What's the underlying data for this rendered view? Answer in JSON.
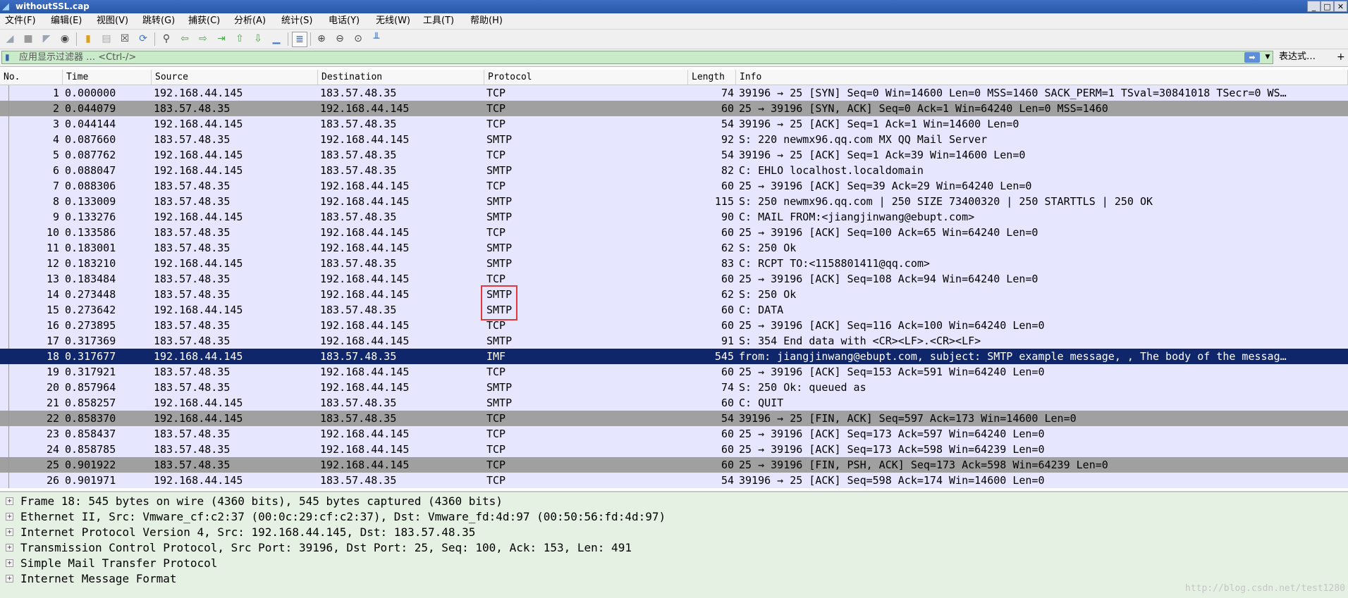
{
  "window": {
    "title": "withoutSSL.cap",
    "buttons": [
      "_",
      "□",
      "✕"
    ]
  },
  "menu": [
    "文件(F)",
    "编辑(E)",
    "视图(V)",
    "跳转(G)",
    "捕获(C)",
    "分析(A)",
    "统计(S)",
    "电话(Y)",
    "无线(W)",
    "工具(T)",
    "帮助(H)"
  ],
  "toolbar": {
    "icons": [
      "shark-fin-icon",
      "stop-icon",
      "restart-icon",
      "options-icon",
      "open-file-icon",
      "save-icon",
      "close-file-icon",
      "reload-icon",
      "find-icon",
      "go-back-icon",
      "go-forward-icon",
      "go-to-packet-icon",
      "first-packet-icon",
      "last-packet-icon",
      "auto-scroll-icon",
      "colorize-icon",
      "zoom-in-icon",
      "zoom-out-icon",
      "zoom-normal-icon",
      "resize-columns-icon"
    ]
  },
  "filter": {
    "placeholder": "应用显示过滤器 … <Ctrl-/>",
    "expression_label": "表达式…",
    "plus_label": "+"
  },
  "columns": {
    "no": "No.",
    "time": "Time",
    "source": "Source",
    "destination": "Destination",
    "protocol": "Protocol",
    "length": "Length",
    "info": "Info"
  },
  "packets": [
    {
      "no": "1",
      "time": "0.000000",
      "src": "192.168.44.145",
      "dst": "183.57.48.35",
      "proto": "TCP",
      "len": "74",
      "info": "39196 → 25 [SYN] Seq=0 Win=14600 Len=0 MSS=1460 SACK_PERM=1 TSval=30841018 TSecr=0 WS…",
      "bg": "#e7e6ff"
    },
    {
      "no": "2",
      "time": "0.044079",
      "src": "183.57.48.35",
      "dst": "192.168.44.145",
      "proto": "TCP",
      "len": "60",
      "info": "25 → 39196 [SYN, ACK] Seq=0 Ack=1 Win=64240 Len=0 MSS=1460",
      "bg": "#a0a0a0"
    },
    {
      "no": "3",
      "time": "0.044144",
      "src": "192.168.44.145",
      "dst": "183.57.48.35",
      "proto": "TCP",
      "len": "54",
      "info": "39196 → 25 [ACK] Seq=1 Ack=1 Win=14600 Len=0",
      "bg": "#e7e6ff"
    },
    {
      "no": "4",
      "time": "0.087660",
      "src": "183.57.48.35",
      "dst": "192.168.44.145",
      "proto": "SMTP",
      "len": "92",
      "info": "S: 220 newmx96.qq.com MX QQ Mail Server",
      "bg": "#e7e6ff"
    },
    {
      "no": "5",
      "time": "0.087762",
      "src": "192.168.44.145",
      "dst": "183.57.48.35",
      "proto": "TCP",
      "len": "54",
      "info": "39196 → 25 [ACK] Seq=1 Ack=39 Win=14600 Len=0",
      "bg": "#e7e6ff"
    },
    {
      "no": "6",
      "time": "0.088047",
      "src": "192.168.44.145",
      "dst": "183.57.48.35",
      "proto": "SMTP",
      "len": "82",
      "info": "C: EHLO localhost.localdomain",
      "bg": "#e7e6ff"
    },
    {
      "no": "7",
      "time": "0.088306",
      "src": "183.57.48.35",
      "dst": "192.168.44.145",
      "proto": "TCP",
      "len": "60",
      "info": "25 → 39196 [ACK] Seq=39 Ack=29 Win=64240 Len=0",
      "bg": "#e7e6ff"
    },
    {
      "no": "8",
      "time": "0.133009",
      "src": "183.57.48.35",
      "dst": "192.168.44.145",
      "proto": "SMTP",
      "len": "115",
      "info": "S: 250 newmx96.qq.com | 250 SIZE 73400320 | 250 STARTTLS | 250 OK",
      "bg": "#e7e6ff"
    },
    {
      "no": "9",
      "time": "0.133276",
      "src": "192.168.44.145",
      "dst": "183.57.48.35",
      "proto": "SMTP",
      "len": "90",
      "info": "C: MAIL FROM:<jiangjinwang@ebupt.com>",
      "bg": "#e7e6ff"
    },
    {
      "no": "10",
      "time": "0.133586",
      "src": "183.57.48.35",
      "dst": "192.168.44.145",
      "proto": "TCP",
      "len": "60",
      "info": "25 → 39196 [ACK] Seq=100 Ack=65 Win=64240 Len=0",
      "bg": "#e7e6ff"
    },
    {
      "no": "11",
      "time": "0.183001",
      "src": "183.57.48.35",
      "dst": "192.168.44.145",
      "proto": "SMTP",
      "len": "62",
      "info": "S: 250 Ok",
      "bg": "#e7e6ff"
    },
    {
      "no": "12",
      "time": "0.183210",
      "src": "192.168.44.145",
      "dst": "183.57.48.35",
      "proto": "SMTP",
      "len": "83",
      "info": "C: RCPT TO:<1158801411@qq.com>",
      "bg": "#e7e6ff"
    },
    {
      "no": "13",
      "time": "0.183484",
      "src": "183.57.48.35",
      "dst": "192.168.44.145",
      "proto": "TCP",
      "len": "60",
      "info": "25 → 39196 [ACK] Seq=108 Ack=94 Win=64240 Len=0",
      "bg": "#e7e6ff"
    },
    {
      "no": "14",
      "time": "0.273448",
      "src": "183.57.48.35",
      "dst": "192.168.44.145",
      "proto": "SMTP",
      "len": "62",
      "info": "S: 250 Ok",
      "bg": "#e7e6ff"
    },
    {
      "no": "15",
      "time": "0.273642",
      "src": "192.168.44.145",
      "dst": "183.57.48.35",
      "proto": "SMTP",
      "len": "60",
      "info": "C: DATA",
      "bg": "#e7e6ff"
    },
    {
      "no": "16",
      "time": "0.273895",
      "src": "183.57.48.35",
      "dst": "192.168.44.145",
      "proto": "TCP",
      "len": "60",
      "info": "25 → 39196 [ACK] Seq=116 Ack=100 Win=64240 Len=0",
      "bg": "#e7e6ff"
    },
    {
      "no": "17",
      "time": "0.317369",
      "src": "183.57.48.35",
      "dst": "192.168.44.145",
      "proto": "SMTP",
      "len": "91",
      "info": "S: 354 End data with <CR><LF>.<CR><LF>",
      "bg": "#e7e6ff"
    },
    {
      "no": "18",
      "time": "0.317677",
      "src": "192.168.44.145",
      "dst": "183.57.48.35",
      "proto": "IMF",
      "len": "545",
      "info": "from: jiangjinwang@ebupt.com, subject: SMTP example message, , The body of the messag…",
      "bg": "#10266b",
      "selected": true
    },
    {
      "no": "19",
      "time": "0.317921",
      "src": "183.57.48.35",
      "dst": "192.168.44.145",
      "proto": "TCP",
      "len": "60",
      "info": "25 → 39196 [ACK] Seq=153 Ack=591 Win=64240 Len=0",
      "bg": "#e7e6ff"
    },
    {
      "no": "20",
      "time": "0.857964",
      "src": "183.57.48.35",
      "dst": "192.168.44.145",
      "proto": "SMTP",
      "len": "74",
      "info": "S: 250 Ok: queued as",
      "bg": "#e7e6ff"
    },
    {
      "no": "21",
      "time": "0.858257",
      "src": "192.168.44.145",
      "dst": "183.57.48.35",
      "proto": "SMTP",
      "len": "60",
      "info": "C: QUIT",
      "bg": "#e7e6ff"
    },
    {
      "no": "22",
      "time": "0.858370",
      "src": "192.168.44.145",
      "dst": "183.57.48.35",
      "proto": "TCP",
      "len": "54",
      "info": "39196 → 25 [FIN, ACK] Seq=597 Ack=173 Win=14600 Len=0",
      "bg": "#a0a0a0"
    },
    {
      "no": "23",
      "time": "0.858437",
      "src": "183.57.48.35",
      "dst": "192.168.44.145",
      "proto": "TCP",
      "len": "60",
      "info": "25 → 39196 [ACK] Seq=173 Ack=597 Win=64240 Len=0",
      "bg": "#e7e6ff"
    },
    {
      "no": "24",
      "time": "0.858785",
      "src": "183.57.48.35",
      "dst": "192.168.44.145",
      "proto": "TCP",
      "len": "60",
      "info": "25 → 39196 [ACK] Seq=173 Ack=598 Win=64239 Len=0",
      "bg": "#e7e6ff"
    },
    {
      "no": "25",
      "time": "0.901922",
      "src": "183.57.48.35",
      "dst": "192.168.44.145",
      "proto": "TCP",
      "len": "60",
      "info": "25 → 39196 [FIN, PSH, ACK] Seq=173 Ack=598 Win=64239 Len=0",
      "bg": "#a0a0a0"
    },
    {
      "no": "26",
      "time": "0.901971",
      "src": "192.168.44.145",
      "dst": "183.57.48.35",
      "proto": "TCP",
      "len": "54",
      "info": "39196 → 25 [ACK] Seq=598 Ack=174 Win=14600 Len=0",
      "bg": "#e7e6ff"
    }
  ],
  "details": [
    "Frame 18: 545 bytes on wire (4360 bits), 545 bytes captured (4360 bits)",
    "Ethernet II, Src: Vmware_cf:c2:37 (00:0c:29:cf:c2:37), Dst: Vmware_fd:4d:97 (00:50:56:fd:4d:97)",
    "Internet Protocol Version 4, Src: 192.168.44.145, Dst: 183.57.48.35",
    "Transmission Control Protocol, Src Port: 39196, Dst Port: 25, Seq: 100, Ack: 153, Len: 491",
    "Simple Mail Transfer Protocol",
    "Internet Message Format"
  ],
  "watermark": "http://blog.csdn.net/test1280",
  "colors": {
    "selected_bg": "#10266b",
    "selected_fg": "#ffffff",
    "normal_bg": "#e7e6ff",
    "gray_bg": "#a0a0a0",
    "filter_bg": "#c9ebc9",
    "highlight_box": "#e2373b"
  }
}
